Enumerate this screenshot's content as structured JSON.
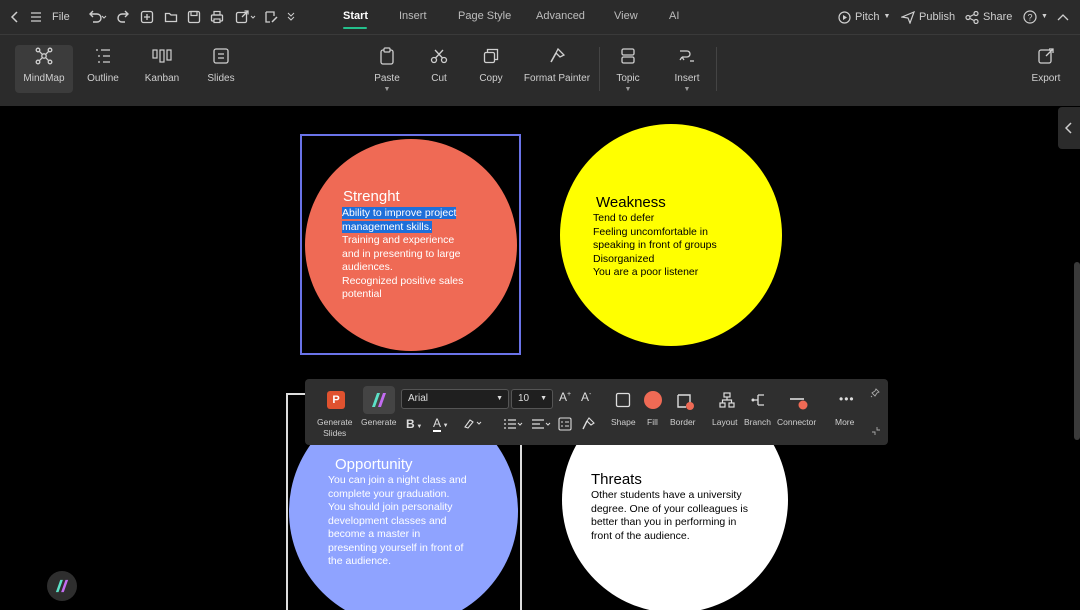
{
  "menu": {
    "file": "File",
    "tabs": [
      "Start",
      "Insert",
      "Page Style",
      "Advanced",
      "View",
      "AI"
    ],
    "pitch": "Pitch",
    "publish": "Publish",
    "share": "Share"
  },
  "ribbon": {
    "views": [
      "MindMap",
      "Outline",
      "Kanban",
      "Slides"
    ],
    "edit": [
      "Paste",
      "Cut",
      "Copy",
      "Format Painter",
      "Topic",
      "Insert"
    ],
    "export": "Export"
  },
  "swot": {
    "strength": {
      "title": "Strenght",
      "selected_lines": [
        "Ability to improve project",
        "management skills."
      ],
      "lines": [
        "Training and experience",
        "and in presenting to large",
        "audiences.",
        "Recognized positive sales",
        "potential"
      ],
      "color": "#ef6a55"
    },
    "weakness": {
      "title": "Weakness",
      "lines": [
        "Tend to defer",
        "Feeling uncomfortable in",
        "speaking in front of groups",
        "Disorganized",
        "You are a poor listener"
      ],
      "color": "#ffff00"
    },
    "opportunity": {
      "title": "Opportunity",
      "lines": [
        "You can join a night class and",
        "complete your graduation.",
        "You should join personality",
        "development classes and",
        "become a master in",
        "presenting yourself in front of",
        "the audience."
      ],
      "color": "#8fa3ff"
    },
    "threats": {
      "title": "Threats",
      "lines": [
        "Other students have a university",
        "degree. One of your colleagues is",
        "better than you in performing in",
        "front of the audience."
      ],
      "color": "#ffffff"
    }
  },
  "floating_toolbar": {
    "generate_slides": [
      "Generate",
      "Slides"
    ],
    "generate": "Generate",
    "font": "Arial",
    "font_size": "10",
    "shape": "Shape",
    "fill": "Fill",
    "border": "Border",
    "layout": "Layout",
    "branch": "Branch",
    "connector": "Connector",
    "more": "More",
    "fill_color": "#ef6a55"
  }
}
